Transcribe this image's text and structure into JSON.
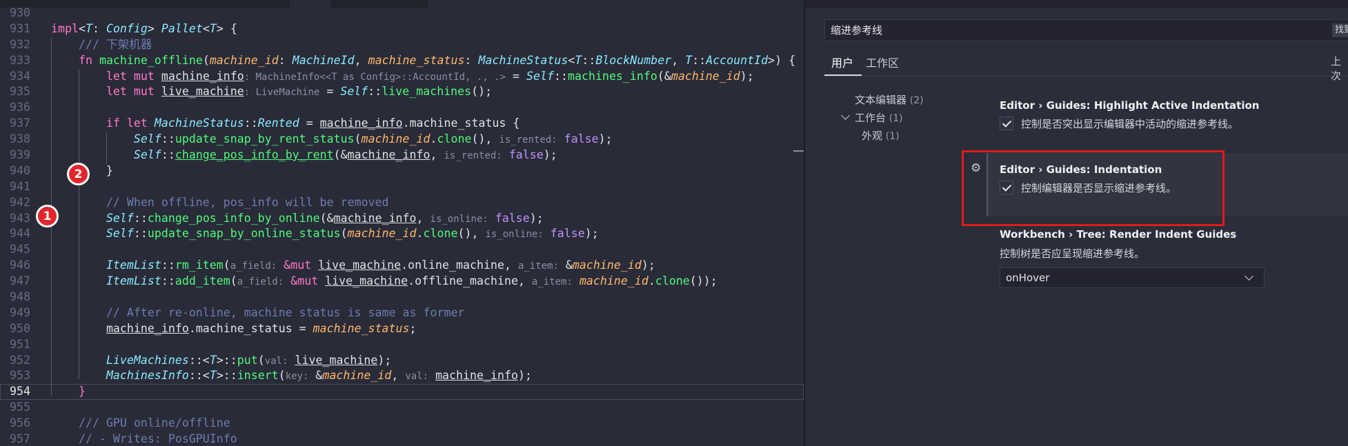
{
  "editor": {
    "lines": [
      {
        "n": "930",
        "html": ""
      },
      {
        "n": "931",
        "html": "<span class='kw'>impl</span>&lt;<span class='ty'>T</span>: <span class='ty'>Config</span>&gt; <span class='ty'>Pallet</span>&lt;<span class='ty'>T</span>&gt; {"
      },
      {
        "n": "932",
        "html": "    <span class='cm'>/// 下架机器</span>"
      },
      {
        "n": "933",
        "html": "    <span class='kw'>fn</span> <span class='fn'>machine_offline</span>(<span class='param'>machine_id</span>: <span class='ty'>MachineId</span>, <span class='param'>machine_status</span>: <span class='ty'>MachineStatus</span>&lt;<span class='ty'>T</span>::<span class='ty'>BlockNumber</span>, <span class='ty'>T</span>::<span class='ty'>AccountId</span>&gt;) {"
      },
      {
        "n": "934",
        "html": "        <span class='kw'>let mut</span> <span class='ul'>machine_info</span><span class='hint'>: MachineInfo&lt;&lt;T as Config&gt;::AccountId, ., .&gt;</span> = <span class='self'>Self</span>::<span class='fn'>machines_info</span>(&amp;<span class='param'>machine_id</span>);"
      },
      {
        "n": "935",
        "html": "        <span class='kw'>let mut</span> <span class='ul'>live_machine</span><span class='hint'>: LiveMachine</span> = <span class='self'>Self</span>::<span class='fn'>live_machines</span>();"
      },
      {
        "n": "936",
        "html": ""
      },
      {
        "n": "937",
        "html": "        <span class='kw'>if let</span> <span class='ty'>MachineStatus</span>::<span class='ty'>Rented</span> = <span class='ul'>machine_info</span>.machine_status {"
      },
      {
        "n": "938",
        "html": "            <span class='self'>Self</span>::<span class='fn'>update_snap_by_rent_status</span>(<span class='param'>machine_id</span>.<span class='fn'>clone</span>(), <span class='hint'>is_rented:</span> <span class='bool'>false</span>);"
      },
      {
        "n": "939",
        "html": "            <span class='self'>Self</span>::<span class='fn ul'>change_pos_info_by_rent</span>(&amp;<span class='ul'>machine_info</span>, <span class='hint'>is_rented:</span> <span class='bool'>false</span>);"
      },
      {
        "n": "940",
        "html": "        }"
      },
      {
        "n": "941",
        "html": ""
      },
      {
        "n": "942",
        "html": "        <span class='cm'>// When offline, pos_info will be removed</span>"
      },
      {
        "n": "943",
        "html": "        <span class='self'>Self</span>::<span class='fn'>change_pos_info_by_online</span>(&amp;<span class='ul'>machine_info</span>, <span class='hint'>is_online:</span> <span class='bool'>false</span>);"
      },
      {
        "n": "944",
        "html": "        <span class='self'>Self</span>::<span class='fn'>update_snap_by_online_status</span>(<span class='param'>machine_id</span>.<span class='fn'>clone</span>(), <span class='hint'>is_online:</span> <span class='bool'>false</span>);"
      },
      {
        "n": "945",
        "html": ""
      },
      {
        "n": "946",
        "html": "        <span class='ty'>ItemList</span>::<span class='fn'>rm_item</span>(<span class='hint'>a_field:</span> <span class='kw'>&amp;mut</span> <span class='ul'>live_machine</span>.online_machine, <span class='hint'>a_item:</span> &amp;<span class='param'>machine_id</span>);"
      },
      {
        "n": "947",
        "html": "        <span class='ty'>ItemList</span>::<span class='fn'>add_item</span>(<span class='hint'>a_field:</span> <span class='kw'>&amp;mut</span> <span class='ul'>live_machine</span>.offline_machine, <span class='hint'>a_item:</span> <span class='param'>machine_id</span>.<span class='fn'>clone</span>());"
      },
      {
        "n": "948",
        "html": ""
      },
      {
        "n": "949",
        "html": "        <span class='cm'>// After re-online, machine status is same as former</span>"
      },
      {
        "n": "950",
        "html": "        <span class='ul'>machine_info</span>.machine_status = <span class='param'>machine_status</span>;"
      },
      {
        "n": "951",
        "html": ""
      },
      {
        "n": "952",
        "html": "        <span class='ty'>LiveMachines</span>::&lt;<span class='ty'>T</span>&gt;::<span class='fn'>put</span>(<span class='hint'>val:</span> <span class='ul'>live_machine</span>);"
      },
      {
        "n": "953",
        "html": "        <span class='ty'>MachinesInfo</span>::&lt;<span class='ty'>T</span>&gt;::<span class='fn'>insert</span>(<span class='hint'>key:</span> &amp;<span class='param'>machine_id</span>, <span class='hint'>val:</span> <span class='ul'>machine_info</span>);"
      },
      {
        "n": "954",
        "html": "    <span class='kw'>}</span>",
        "current": true
      },
      {
        "n": "955",
        "html": ""
      },
      {
        "n": "956",
        "html": "    <span class='cm'>/// GPU online/offline</span>"
      },
      {
        "n": "957",
        "html": "    <span class='cm'>// - Writes: PosGPUInfo</span>"
      }
    ],
    "badges": [
      "1",
      "2"
    ]
  },
  "settings": {
    "search_value": "缩进参考线",
    "search_button": "找到",
    "tabs": [
      "用户",
      "工作区"
    ],
    "last_sync": "上次",
    "toc": [
      {
        "label": "文本编辑器",
        "count": "(2)"
      },
      {
        "label": "工作台",
        "count": "(1)"
      },
      {
        "label": "外观",
        "count": "(1)"
      }
    ],
    "items": [
      {
        "title": "Editor › Guides: Highlight Active Indentation",
        "desc": "控制是否突出显示编辑器中活动的缩进参考线。"
      },
      {
        "title": "Editor › Guides: Indentation",
        "desc": "控制编辑器是否显示缩进参考线。"
      },
      {
        "title": "Workbench › Tree: Render Indent Guides",
        "desc": "控制树是否应呈现缩进参考线。",
        "select": "onHover"
      }
    ]
  }
}
